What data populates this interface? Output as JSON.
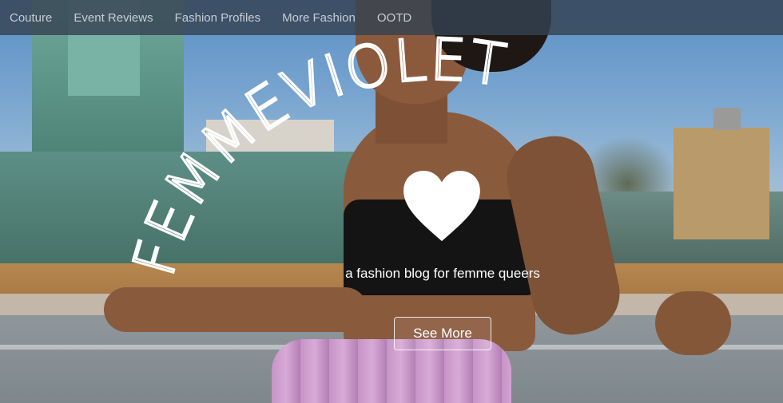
{
  "nav": {
    "items": [
      {
        "label": "Couture"
      },
      {
        "label": "Event Reviews"
      },
      {
        "label": "Fashion Profiles"
      },
      {
        "label": "More Fashion"
      },
      {
        "label": "OOTD"
      }
    ]
  },
  "hero": {
    "title": "FEMMEVIOLET",
    "tagline": "a fashion blog for femme queers",
    "cta_label": "See More",
    "logo_icon": "heart-icon"
  },
  "colors": {
    "nav_bg": "#344252",
    "nav_text": "#c7cdd3",
    "title": "#ffffff"
  }
}
